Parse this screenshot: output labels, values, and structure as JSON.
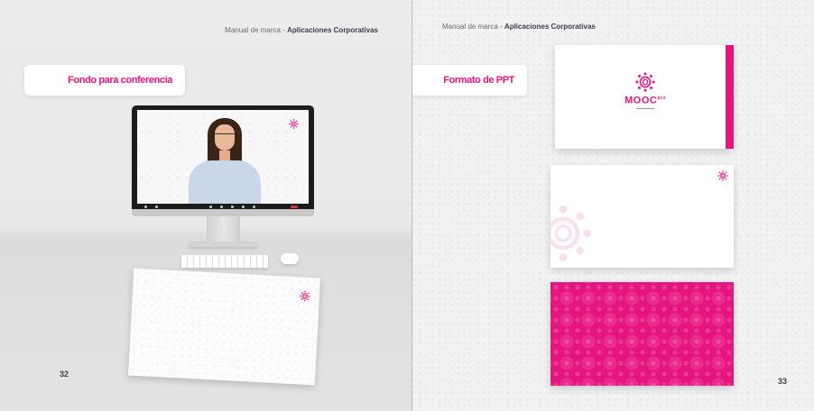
{
  "left_page": {
    "header": {
      "prefix": "Manual de marca - ",
      "section": "Aplicaciones Corporativas"
    },
    "title": "Fondo para conferencia",
    "page_number": "32"
  },
  "right_page": {
    "header": {
      "prefix": "Manual de marca - ",
      "section": "Aplicaciones Corporativas"
    },
    "title": "Formato de PPT",
    "page_number": "33",
    "logo": {
      "wordmark": "MOOC",
      "superscript": "pro"
    }
  },
  "colors": {
    "brand_pink": "#e5157f",
    "text_dark": "#3d3d4d",
    "text_gray": "#6b6b6b"
  },
  "icons": [
    "mandala-logo-icon"
  ]
}
